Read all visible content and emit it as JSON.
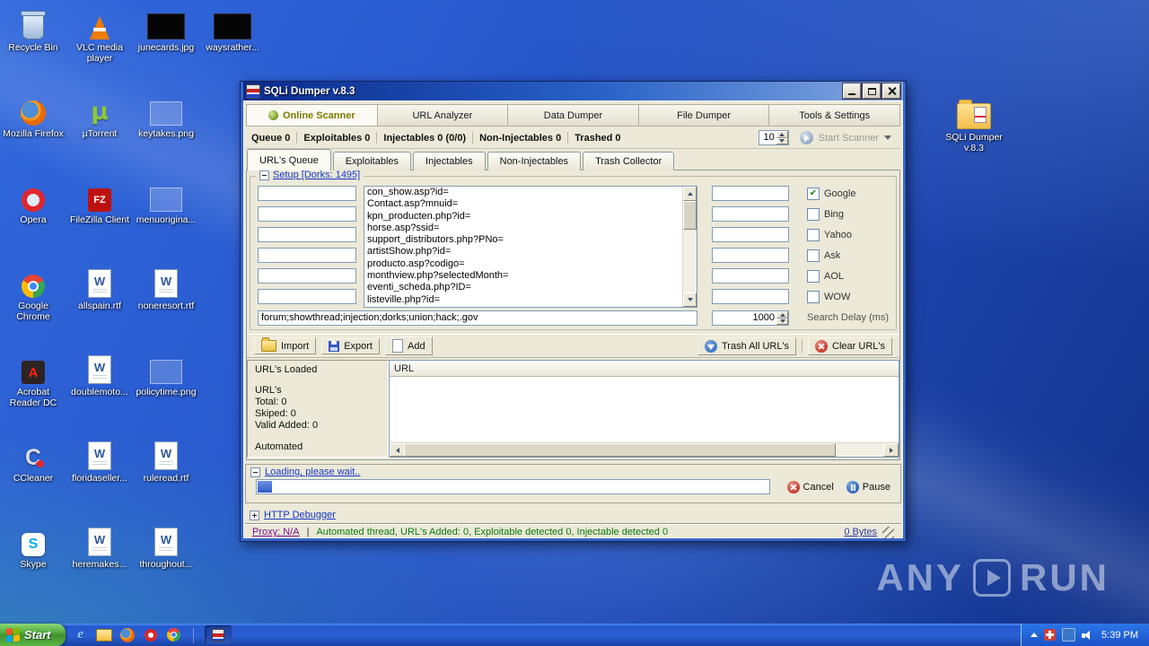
{
  "desktop": {
    "icons": [
      {
        "label": "Recycle Bin"
      },
      {
        "label": "VLC media player"
      },
      {
        "label": "junecards.jpg"
      },
      {
        "label": "waysrather..."
      },
      {
        "label": "Mozilla Firefox"
      },
      {
        "label": "µTorrent"
      },
      {
        "label": "keytakes.png"
      },
      {
        "label": "Opera"
      },
      {
        "label": "FileZilla Client"
      },
      {
        "label": "menuorigina..."
      },
      {
        "label": "Google Chrome"
      },
      {
        "label": "allspain.rtf"
      },
      {
        "label": "noneresort.rtf"
      },
      {
        "label": "Acrobat Reader DC"
      },
      {
        "label": "doublemoto..."
      },
      {
        "label": "policytime.png"
      },
      {
        "label": "CCleaner"
      },
      {
        "label": "floridaseller..."
      },
      {
        "label": "ruleread.rtf"
      },
      {
        "label": "Skype"
      },
      {
        "label": "heremakes..."
      },
      {
        "label": "throughout..."
      },
      {
        "label": "SQLi Dumper v.8.3"
      }
    ],
    "watermark": {
      "any": "ANY",
      "run": "RUN"
    }
  },
  "window": {
    "title": "SQLi Dumper v.8.3",
    "main_tabs": [
      "Online Scanner",
      "URL Analyzer",
      "Data Dumper",
      "File Dumper",
      "Tools & Settings"
    ],
    "counters": [
      "Queue 0",
      "Exploitables 0",
      "Injectables 0 (0/0)",
      "Non-Injectables 0",
      "Trashed 0"
    ],
    "threads_value": "10",
    "start_scanner": "Start Scanner",
    "inner_tabs": [
      "URL's Queue",
      "Exploitables",
      "Injectables",
      "Non-Injectables",
      "Trash Collector"
    ],
    "setup": {
      "group_label": "Setup [Dorks: 1495]",
      "dorks": [
        "con_show.asp?id=",
        "Contact.asp?mnuid=",
        "kpn_producten.php?id=",
        "horse.asp?ssid=",
        "support_distributors.php?PNo=",
        "artistShow.php?id=",
        "producto.asp?codigo=",
        "monthview.php?selectedMonth=",
        "eventi_scheda.php?ID=",
        "listeville.php?id="
      ],
      "keywords": "forum;showthread;injection;dorks;union;hack;.gov",
      "delay_value": "1000",
      "delay_label": "Search Delay (ms)",
      "engines": [
        {
          "label": "Google",
          "mark": "✔"
        },
        {
          "label": "Bing",
          "mark": ""
        },
        {
          "label": "Yahoo",
          "mark": ""
        },
        {
          "label": "Ask",
          "mark": ""
        },
        {
          "label": "AOL",
          "mark": ""
        },
        {
          "label": "WOW",
          "mark": ""
        }
      ]
    },
    "toolbar": {
      "import": "Import",
      "export": "Export",
      "add": "Add",
      "trash_all": "Trash All URL's",
      "clear": "Clear URL's"
    },
    "loaded": {
      "header": "URL's Loaded",
      "lines": [
        "URL's",
        "Total: 0",
        "Skiped: 0",
        "Valid Added: 0"
      ],
      "automated": "Automated",
      "column": "URL"
    },
    "progress": {
      "header": "Loading, please wait..",
      "cancel": "Cancel",
      "pause": "Pause"
    },
    "http_debugger": "HTTP Debugger",
    "statusbar": {
      "proxy": "Proxy: N/A",
      "sep": "|",
      "status": "Automated thread, URL's Added: 0, Exploitable detected 0, Injectable detected 0",
      "bytes": "0 Bytes"
    }
  },
  "taskbar": {
    "start": "Start",
    "time": "5:39 PM"
  }
}
